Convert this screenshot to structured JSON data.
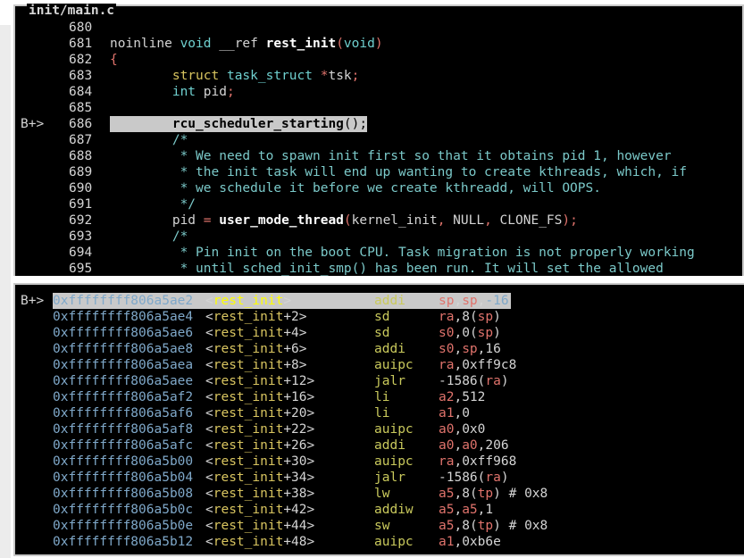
{
  "window": {
    "title": "init/main.c"
  },
  "source": {
    "lines": [
      {
        "no": "680",
        "bp": "",
        "parts": []
      },
      {
        "no": "681",
        "bp": "",
        "parts": [
          [
            "p",
            "noinline "
          ],
          [
            "ty",
            "void"
          ],
          [
            "p",
            " __ref "
          ],
          [
            "fn",
            "rest_init"
          ],
          [
            "pu",
            "("
          ],
          [
            "ty",
            "void"
          ],
          [
            "pu",
            ")"
          ]
        ]
      },
      {
        "no": "682",
        "bp": "",
        "parts": [
          [
            "pu",
            "{"
          ]
        ]
      },
      {
        "no": "683",
        "bp": "",
        "parts": [
          [
            "p",
            "        "
          ],
          [
            "kw",
            "struct"
          ],
          [
            "p",
            " "
          ],
          [
            "ty",
            "task_struct"
          ],
          [
            "p",
            " "
          ],
          [
            "pu",
            "*"
          ],
          [
            "p",
            "tsk"
          ],
          [
            "pu",
            ";"
          ]
        ]
      },
      {
        "no": "684",
        "bp": "",
        "parts": [
          [
            "p",
            "        "
          ],
          [
            "ty",
            "int"
          ],
          [
            "p",
            " pid"
          ],
          [
            "pu",
            ";"
          ]
        ]
      },
      {
        "no": "685",
        "bp": "",
        "parts": []
      },
      {
        "no": "686",
        "bp": "B+>",
        "highlight": true,
        "parts": [
          [
            "p",
            "        "
          ],
          [
            "fn",
            "rcu_scheduler_starting"
          ],
          [
            "pu",
            "();"
          ]
        ]
      },
      {
        "no": "687",
        "bp": "",
        "parts": [
          [
            "p",
            "        "
          ],
          [
            "cm",
            "/*"
          ]
        ]
      },
      {
        "no": "688",
        "bp": "",
        "parts": [
          [
            "p",
            "        "
          ],
          [
            "cm",
            " * We need to spawn init first so that it obtains pid 1, however"
          ]
        ]
      },
      {
        "no": "689",
        "bp": "",
        "parts": [
          [
            "p",
            "        "
          ],
          [
            "cm",
            " * the init task will end up wanting to create kthreads, which, if"
          ]
        ]
      },
      {
        "no": "690",
        "bp": "",
        "parts": [
          [
            "p",
            "        "
          ],
          [
            "cm",
            " * we schedule it before we create kthreadd, will OOPS."
          ]
        ]
      },
      {
        "no": "691",
        "bp": "",
        "parts": [
          [
            "p",
            "        "
          ],
          [
            "cm",
            " */"
          ]
        ]
      },
      {
        "no": "692",
        "bp": "",
        "parts": [
          [
            "p",
            "        pid "
          ],
          [
            "pu",
            "="
          ],
          [
            "p",
            " "
          ],
          [
            "fn",
            "user_mode_thread"
          ],
          [
            "pu",
            "("
          ],
          [
            "p",
            "kernel_init"
          ],
          [
            "pu",
            ","
          ],
          [
            "p",
            " NULL"
          ],
          [
            "pu",
            ","
          ],
          [
            "p",
            " CLONE_FS"
          ],
          [
            "pu",
            ");"
          ]
        ]
      },
      {
        "no": "693",
        "bp": "",
        "parts": [
          [
            "p",
            "        "
          ],
          [
            "cm",
            "/*"
          ]
        ]
      },
      {
        "no": "694",
        "bp": "",
        "parts": [
          [
            "p",
            "        "
          ],
          [
            "cm",
            " * Pin init on the boot CPU. Task migration is not properly working"
          ]
        ]
      },
      {
        "no": "695",
        "bp": "",
        "parts": [
          [
            "p",
            "        "
          ],
          [
            "cm",
            " * until sched_init_smp() has been run. It will set the allowed"
          ]
        ]
      }
    ]
  },
  "asm": {
    "rows": [
      {
        "bp": "B+>",
        "addr": "0xffffffff806a5ae2",
        "sym": "rest_init",
        "off": "",
        "mn": "addi",
        "ops": [
          [
            "r",
            "sp"
          ],
          [
            "p",
            ","
          ],
          [
            "r",
            "sp"
          ],
          [
            "p",
            ","
          ],
          [
            "n",
            "-16"
          ]
        ],
        "highlight": true
      },
      {
        "bp": "",
        "addr": "0xffffffff806a5ae4",
        "sym": "rest_init",
        "off": "+2",
        "mn": "sd",
        "ops": [
          [
            "r",
            "ra"
          ],
          [
            "p",
            ","
          ],
          [
            "p",
            "8"
          ],
          [
            "p",
            "("
          ],
          [
            "r",
            "sp"
          ],
          [
            "p",
            ")"
          ]
        ]
      },
      {
        "bp": "",
        "addr": "0xffffffff806a5ae6",
        "sym": "rest_init",
        "off": "+4",
        "mn": "sd",
        "ops": [
          [
            "r",
            "s0"
          ],
          [
            "p",
            ","
          ],
          [
            "p",
            "0"
          ],
          [
            "p",
            "("
          ],
          [
            "r",
            "sp"
          ],
          [
            "p",
            ")"
          ]
        ]
      },
      {
        "bp": "",
        "addr": "0xffffffff806a5ae8",
        "sym": "rest_init",
        "off": "+6",
        "mn": "addi",
        "ops": [
          [
            "r",
            "s0"
          ],
          [
            "p",
            ","
          ],
          [
            "r",
            "sp"
          ],
          [
            "p",
            ","
          ],
          [
            "p",
            "16"
          ]
        ]
      },
      {
        "bp": "",
        "addr": "0xffffffff806a5aea",
        "sym": "rest_init",
        "off": "+8",
        "mn": "auipc",
        "ops": [
          [
            "r",
            "ra"
          ],
          [
            "p",
            ","
          ],
          [
            "p",
            "0xff9c8"
          ]
        ]
      },
      {
        "bp": "",
        "addr": "0xffffffff806a5aee",
        "sym": "rest_init",
        "off": "+12",
        "mn": "jalr",
        "ops": [
          [
            "p",
            "-1586"
          ],
          [
            "p",
            "("
          ],
          [
            "r",
            "ra"
          ],
          [
            "p",
            ")"
          ]
        ]
      },
      {
        "bp": "",
        "addr": "0xffffffff806a5af2",
        "sym": "rest_init",
        "off": "+16",
        "mn": "li",
        "ops": [
          [
            "r",
            "a2"
          ],
          [
            "p",
            ","
          ],
          [
            "p",
            "512"
          ]
        ]
      },
      {
        "bp": "",
        "addr": "0xffffffff806a5af6",
        "sym": "rest_init",
        "off": "+20",
        "mn": "li",
        "ops": [
          [
            "r",
            "a1"
          ],
          [
            "p",
            ","
          ],
          [
            "p",
            "0"
          ]
        ]
      },
      {
        "bp": "",
        "addr": "0xffffffff806a5af8",
        "sym": "rest_init",
        "off": "+22",
        "mn": "auipc",
        "ops": [
          [
            "r",
            "a0"
          ],
          [
            "p",
            ","
          ],
          [
            "p",
            "0x0"
          ]
        ]
      },
      {
        "bp": "",
        "addr": "0xffffffff806a5afc",
        "sym": "rest_init",
        "off": "+26",
        "mn": "addi",
        "ops": [
          [
            "r",
            "a0"
          ],
          [
            "p",
            ","
          ],
          [
            "r",
            "a0"
          ],
          [
            "p",
            ","
          ],
          [
            "p",
            "206"
          ]
        ]
      },
      {
        "bp": "",
        "addr": "0xffffffff806a5b00",
        "sym": "rest_init",
        "off": "+30",
        "mn": "auipc",
        "ops": [
          [
            "r",
            "ra"
          ],
          [
            "p",
            ","
          ],
          [
            "p",
            "0xff968"
          ]
        ]
      },
      {
        "bp": "",
        "addr": "0xffffffff806a5b04",
        "sym": "rest_init",
        "off": "+34",
        "mn": "jalr",
        "ops": [
          [
            "p",
            "-1586"
          ],
          [
            "p",
            "("
          ],
          [
            "r",
            "ra"
          ],
          [
            "p",
            ")"
          ]
        ]
      },
      {
        "bp": "",
        "addr": "0xffffffff806a5b08",
        "sym": "rest_init",
        "off": "+38",
        "mn": "lw",
        "ops": [
          [
            "r",
            "a5"
          ],
          [
            "p",
            ","
          ],
          [
            "p",
            "8"
          ],
          [
            "p",
            "("
          ],
          [
            "r",
            "tp"
          ],
          [
            "p",
            ")"
          ],
          [
            "p",
            " # 0x8"
          ]
        ]
      },
      {
        "bp": "",
        "addr": "0xffffffff806a5b0c",
        "sym": "rest_init",
        "off": "+42",
        "mn": "addiw",
        "ops": [
          [
            "r",
            "a5"
          ],
          [
            "p",
            ","
          ],
          [
            "r",
            "a5"
          ],
          [
            "p",
            ","
          ],
          [
            "p",
            "1"
          ]
        ]
      },
      {
        "bp": "",
        "addr": "0xffffffff806a5b0e",
        "sym": "rest_init",
        "off": "+44",
        "mn": "sw",
        "ops": [
          [
            "r",
            "a5"
          ],
          [
            "p",
            ","
          ],
          [
            "p",
            "8"
          ],
          [
            "p",
            "("
          ],
          [
            "r",
            "tp"
          ],
          [
            "p",
            ")"
          ],
          [
            "p",
            " # 0x8"
          ]
        ]
      },
      {
        "bp": "",
        "addr": "0xffffffff806a5b12",
        "sym": "rest_init",
        "off": "+48",
        "mn": "auipc",
        "ops": [
          [
            "r",
            "a1"
          ],
          [
            "p",
            ","
          ],
          [
            "p",
            "0xb6e"
          ]
        ]
      }
    ]
  }
}
